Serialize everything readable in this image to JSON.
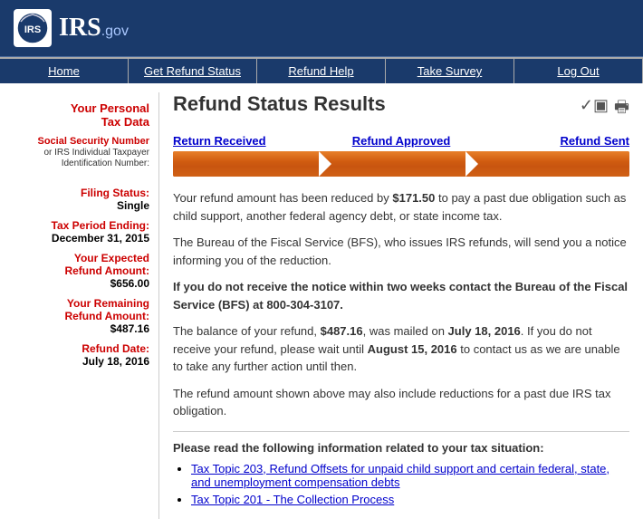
{
  "header": {
    "logo_text": "IRS",
    "logo_gov": ".gov",
    "logo_icon_text": "IRS"
  },
  "nav": {
    "items": [
      {
        "label": "Home",
        "id": "nav-home"
      },
      {
        "label": "Get Refund Status",
        "id": "nav-refund-status"
      },
      {
        "label": "Refund Help",
        "id": "nav-refund-help"
      },
      {
        "label": "Take Survey",
        "id": "nav-survey"
      },
      {
        "label": "Log Out",
        "id": "nav-logout"
      }
    ]
  },
  "sidebar": {
    "section_title_line1": "Your Personal",
    "section_title_line2": "Tax Data",
    "fields": [
      {
        "label": "Social Security Number",
        "sublabel": "or IRS Individual Taxpayer Identification Number:",
        "value": ""
      },
      {
        "label": "Filing Status:",
        "value": "Single"
      },
      {
        "label": "Tax Period Ending:",
        "value": "December 31, 2015"
      },
      {
        "label": "Your Expected Refund Amount:",
        "value": "$656.00"
      },
      {
        "label": "Your Remaining Refund Amount:",
        "value": "$487.16"
      },
      {
        "label": "Refund Date:",
        "value": "July 18, 2016"
      }
    ]
  },
  "content": {
    "page_title": "Refund Status Results",
    "progress": {
      "step1": "Return Received",
      "step2": "Refund Approved",
      "step3": "Refund Sent"
    },
    "messages": [
      {
        "id": "msg1",
        "text": "Your refund amount has been reduced by $171.50 to pay a past due obligation such as child support, another federal agency debt, or state income tax.",
        "bold_parts": [
          "$171.50"
        ]
      },
      {
        "id": "msg2",
        "text": "The Bureau of the Fiscal Service (BFS), who issues IRS refunds, will send you a notice informing you of the reduction."
      },
      {
        "id": "msg3",
        "alert": true,
        "text": "If you do not receive the notice within two weeks contact the Bureau of the Fiscal Service (BFS) at 800-304-3107."
      },
      {
        "id": "msg4",
        "text": "The balance of your refund, $487.16, was mailed on July 18, 2016. If you do not receive your refund, please wait until August 15, 2016 to contact us as we are unable to take any further action until then.",
        "bold_parts": [
          "$487.16",
          "July 18, 2016",
          "August 15, 2016"
        ]
      },
      {
        "id": "msg5",
        "text": "The refund amount shown above may also include reductions for a past due IRS tax obligation."
      }
    ],
    "read_section": {
      "title": "Please read the following information related to your tax situation:",
      "links": [
        {
          "text": "Tax Topic 203, Refund Offsets for unpaid child support and certain federal, state, and unemployment compensation debts",
          "href": "#"
        },
        {
          "text": "Tax Topic 201 - The Collection Process",
          "href": "#"
        }
      ]
    }
  }
}
